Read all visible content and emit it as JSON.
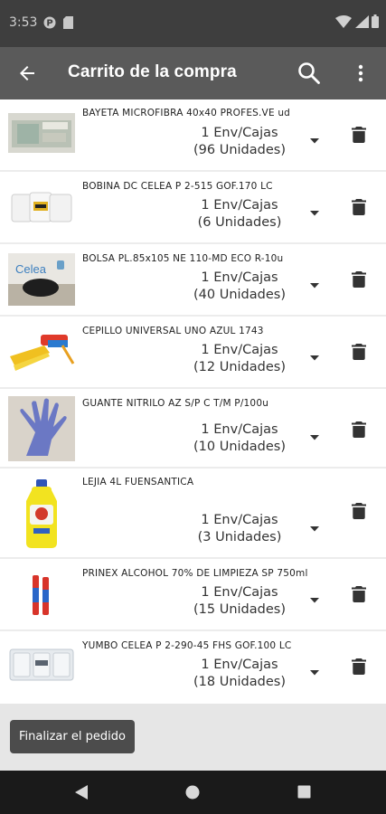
{
  "status": {
    "time": "3:53"
  },
  "header": {
    "title": "Carrito de la compra",
    "back_icon": "arrow-back-icon",
    "search_icon": "search-icon",
    "menu_icon": "more-vert-icon"
  },
  "items": [
    {
      "name": "BAYETA MICROFIBRA 40x40 PROFES.VE ud",
      "qty": "1 Env/Cajas",
      "units": "(96 Unidades)"
    },
    {
      "name": "BOBINA DC CELEA P 2-515 GOF.170 LC",
      "qty": "1 Env/Cajas",
      "units": "(6 Unidades)"
    },
    {
      "name": "BOLSA PL.85x105 NE 110-MD ECO R-10u",
      "qty": "1 Env/Cajas",
      "units": "(40 Unidades)",
      "thumb_brand": "Celea"
    },
    {
      "name": "CEPILLO UNIVERSAL UNO AZUL 1743",
      "qty": "1 Env/Cajas",
      "units": "(12 Unidades)"
    },
    {
      "name": "GUANTE NITRILO AZ S/P C T/M P/100u",
      "qty": "1 Env/Cajas",
      "units": "(10 Unidades)"
    },
    {
      "name": "LEJIA 4L FUENSANTICA",
      "qty": "1 Env/Cajas",
      "units": "(3 Unidades)"
    },
    {
      "name": "PRINEX ALCOHOL 70% DE LIMPIEZA SP 750ml",
      "qty": "1 Env/Cajas",
      "units": "(15 Unidades)"
    },
    {
      "name": "YUMBO CELEA P 2-290-45 FHS GOF.100 LC",
      "qty": "1 Env/Cajas",
      "units": "(18 Unidades)"
    }
  ],
  "footer": {
    "finish_label": "Finalizar el pedido"
  },
  "colors": {
    "status_bar": "#3e3e3e",
    "app_bar": "#5a5a5a",
    "button": "#4c4c4c",
    "nav_bar": "#1a1a1a"
  }
}
